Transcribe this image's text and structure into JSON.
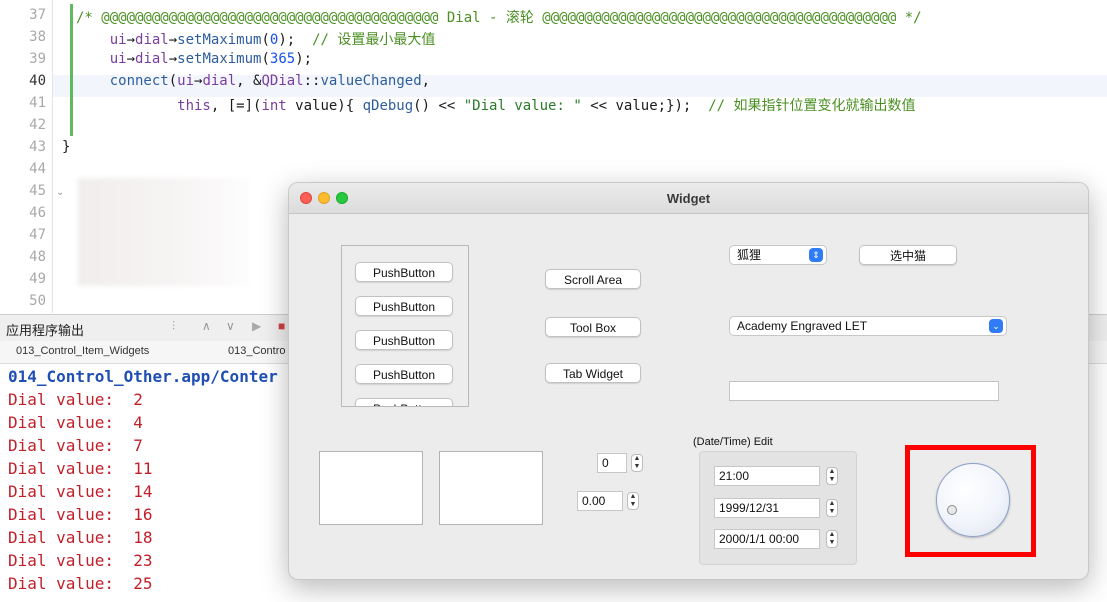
{
  "editor": {
    "lines": [
      {
        "num": "37",
        "segments": [
          {
            "t": "/* @@@@@@@@@@@@@@@@@@@@@@@@@@@@@@@@@@@@@@@@ Dial - 滚轮 @@@@@@@@@@@@@@@@@@@@@@@@@@@@@@@@@@@@@@@@@@ */",
            "c": "c-cmt"
          }
        ]
      },
      {
        "num": "38",
        "segments": [
          {
            "t": "    ui",
            "c": "c-kw"
          },
          {
            "t": "→",
            "c": "c-txt"
          },
          {
            "t": "dial",
            "c": "c-kw"
          },
          {
            "t": "→",
            "c": "c-txt"
          },
          {
            "t": "setMaximum",
            "c": "c-fn"
          },
          {
            "t": "(",
            "c": "c-txt"
          },
          {
            "t": "0",
            "c": "c-num"
          },
          {
            "t": ");  ",
            "c": "c-txt"
          },
          {
            "t": "// 设置最小最大值",
            "c": "c-cmt"
          }
        ]
      },
      {
        "num": "39",
        "segments": [
          {
            "t": "    ui",
            "c": "c-kw"
          },
          {
            "t": "→",
            "c": "c-txt"
          },
          {
            "t": "dial",
            "c": "c-kw"
          },
          {
            "t": "→",
            "c": "c-txt"
          },
          {
            "t": "setMaximum",
            "c": "c-fn"
          },
          {
            "t": "(",
            "c": "c-txt"
          },
          {
            "t": "365",
            "c": "c-num"
          },
          {
            "t": ");",
            "c": "c-txt"
          }
        ]
      },
      {
        "num": "40",
        "segments": [
          {
            "t": "    connect",
            "c": "c-fn"
          },
          {
            "t": "(",
            "c": "c-txt"
          },
          {
            "t": "ui",
            "c": "c-kw"
          },
          {
            "t": "→",
            "c": "c-txt"
          },
          {
            "t": "dial",
            "c": "c-kw"
          },
          {
            "t": ", &",
            "c": "c-txt"
          },
          {
            "t": "QDial",
            "c": "c-kw"
          },
          {
            "t": "::",
            "c": "c-txt"
          },
          {
            "t": "valueChanged",
            "c": "c-fn"
          },
          {
            "t": ",",
            "c": "c-txt"
          }
        ]
      },
      {
        "num": "41",
        "segments": [
          {
            "t": "            this",
            "c": "c-kw"
          },
          {
            "t": ", [=](",
            "c": "c-txt"
          },
          {
            "t": "int",
            "c": "c-kw"
          },
          {
            "t": " value){ ",
            "c": "c-txt"
          },
          {
            "t": "qDebug",
            "c": "c-fn"
          },
          {
            "t": "() << ",
            "c": "c-txt"
          },
          {
            "t": "\"Dial value: \"",
            "c": "c-str"
          },
          {
            "t": " << value;});  ",
            "c": "c-txt"
          },
          {
            "t": "// 如果指针位置变化就输出数值",
            "c": "c-cmt"
          }
        ]
      },
      {
        "num": "42",
        "segments": []
      },
      {
        "num": "43",
        "segments": [
          {
            "t": "}",
            "c": "c-txt"
          }
        ]
      },
      {
        "num": "44",
        "segments": []
      },
      {
        "num": "45",
        "segments": []
      },
      {
        "num": "46",
        "segments": []
      },
      {
        "num": "47",
        "segments": []
      },
      {
        "num": "48",
        "segments": []
      },
      {
        "num": "49",
        "segments": []
      },
      {
        "num": "50",
        "segments": []
      }
    ]
  },
  "output": {
    "title": "应用程序输出",
    "tabs": [
      "013_Control_Item_Widgets",
      "013_Contro"
    ],
    "path_line": "014_Control_Other.app/Conter",
    "lines": [
      "Dial value:  2",
      "Dial value:  4",
      "Dial value:  7",
      "Dial value:  11",
      "Dial value:  14",
      "Dial value:  16",
      "Dial value:  18",
      "Dial value:  23",
      "Dial value:  25"
    ]
  },
  "widget": {
    "title": "Widget",
    "push_buttons": [
      "PushButton",
      "PushButton",
      "PushButton",
      "PushButton",
      "PushButton"
    ],
    "scroll_area": "Scroll Area",
    "tool_box": "Tool Box",
    "tab_widget": "Tab Widget",
    "combo_animal": "狐狸",
    "select_cat": "选中猫",
    "font_combo": "Academy Engraved LET",
    "line_edit_value": "",
    "spin_int": "0",
    "spin_double": "0.00",
    "datetime_label": "(Date/Time) Edit",
    "time_edit": "21:00",
    "date_edit": "1999/12/31",
    "datetime_edit": "2000/1/1 00:00"
  }
}
